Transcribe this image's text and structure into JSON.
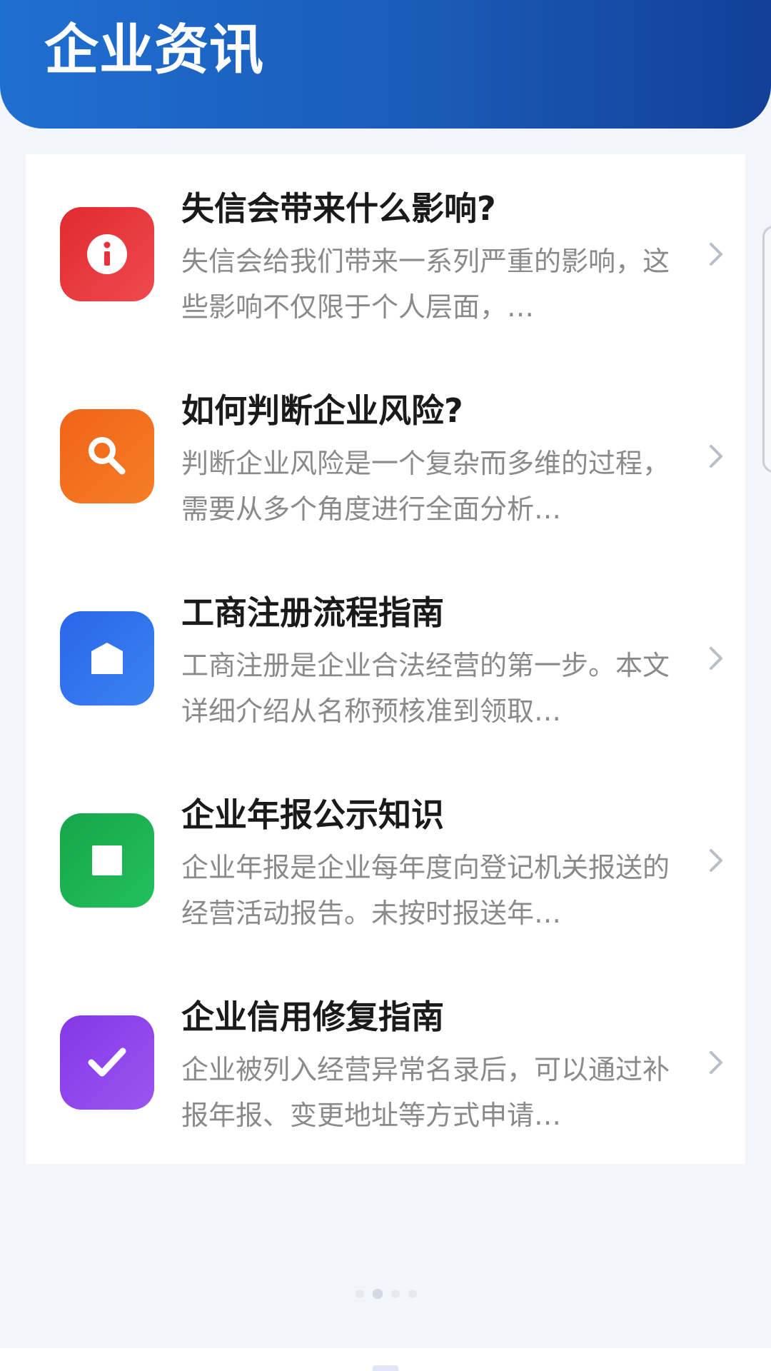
{
  "header": {
    "title": "企业资讯",
    "gradient_start": "#1f6fd1",
    "gradient_end": "#123f98"
  },
  "articles": [
    {
      "title": "失信会带来什么影响?",
      "summary": "失信会给我们带来一系列严重的影响，这些影响不仅限于个人层面，…",
      "icon": "info-icon",
      "color": "#e5343b"
    },
    {
      "title": "如何判断企业风险?",
      "summary": "判断企业风险是一个复杂而多维的过程，需要从多个角度进行全面分析…",
      "icon": "search-icon",
      "color": "#f36c1a"
    },
    {
      "title": "工商注册流程指南",
      "summary": "工商注册是企业合法经营的第一步。本文详细介绍从名称预核准到领取…",
      "icon": "building-icon",
      "color": "#2f72ec"
    },
    {
      "title": "企业年报公示知识",
      "summary": "企业年报是企业每年度向登记机关报送的经营活动报告。未按时报送年…",
      "icon": "document-icon",
      "color": "#1fb255"
    },
    {
      "title": "企业信用修复指南",
      "summary": "企业被列入经营异常名录后，可以通过补报年报、变更地址等方式申请…",
      "icon": "check-icon",
      "color": "#8d45ea"
    }
  ],
  "pager": {
    "count": 4,
    "active_index": 1
  }
}
